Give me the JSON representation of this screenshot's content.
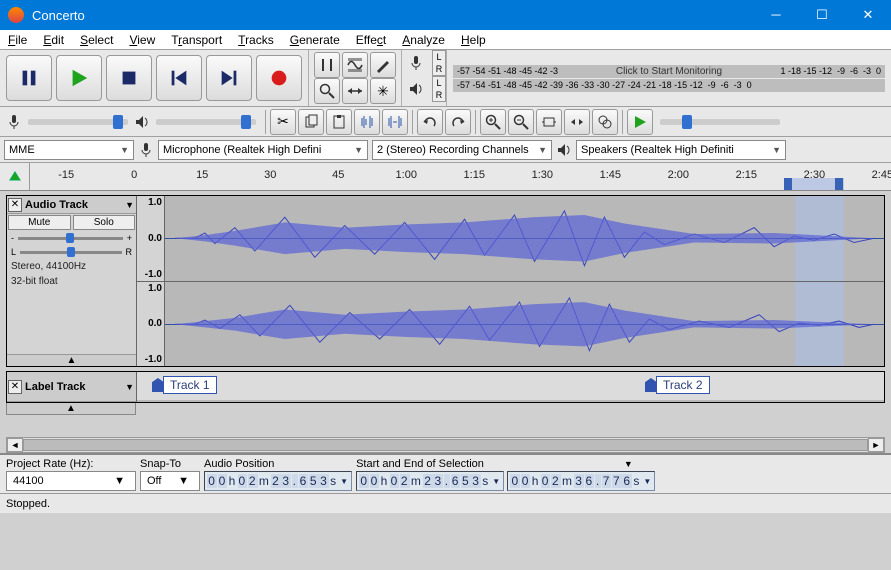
{
  "title": "Concerto",
  "menus": [
    "File",
    "Edit",
    "Select",
    "View",
    "Transport",
    "Tracks",
    "Generate",
    "Effect",
    "Analyze",
    "Help"
  ],
  "monitor_hint": "Click to Start Monitoring",
  "meter_lr": {
    "l": "L",
    "r": "R"
  },
  "db_scale_rec": [
    "-57",
    "-54",
    "-51",
    "-48",
    "-45",
    "-42",
    "-3"
  ],
  "db_scale_rec_right": [
    "1",
    "-18",
    "-15",
    "-12",
    "-9",
    "-6",
    "-3",
    "0"
  ],
  "db_scale_play": [
    "-57",
    "-54",
    "-51",
    "-48",
    "-45",
    "-42",
    "-39",
    "-36",
    "-33",
    "-30",
    "-27",
    "-24",
    "-21",
    "-18",
    "-15",
    "-12",
    "-9",
    "-6",
    "-3",
    "0"
  ],
  "device_host": "MME",
  "device_in": "Microphone (Realtek High Defini",
  "channels": "2 (Stereo) Recording Channels",
  "device_out": "Speakers (Realtek High Definiti",
  "timeline_ticks": [
    "-15",
    "0",
    "15",
    "30",
    "45",
    "1:00",
    "1:15",
    "1:30",
    "1:45",
    "2:00",
    "2:15",
    "2:30",
    "2:45"
  ],
  "track": {
    "name": "Audio Track",
    "mute": "Mute",
    "solo": "Solo",
    "pan_l": "L",
    "pan_r": "R",
    "gain_minus": "-",
    "gain_plus": "+",
    "info1": "Stereo, 44100Hz",
    "info2": "32-bit float",
    "scale_top": "1.0",
    "scale_mid": "0.0",
    "scale_bot": "-1.0"
  },
  "label_track": {
    "name": "Label Track",
    "labels": [
      "Track 1",
      "Track 2"
    ]
  },
  "bottom": {
    "proj_rate_label": "Project Rate (Hz):",
    "proj_rate": "44100",
    "snap_label": "Snap-To",
    "snap": "Off",
    "pos_label": "Audio Position",
    "pos": "00h02m23.653s",
    "sel_label": "Start and End of Selection",
    "sel_start": "00h02m23.653s",
    "sel_end": "00h02m36.776s"
  },
  "status": "Stopped."
}
